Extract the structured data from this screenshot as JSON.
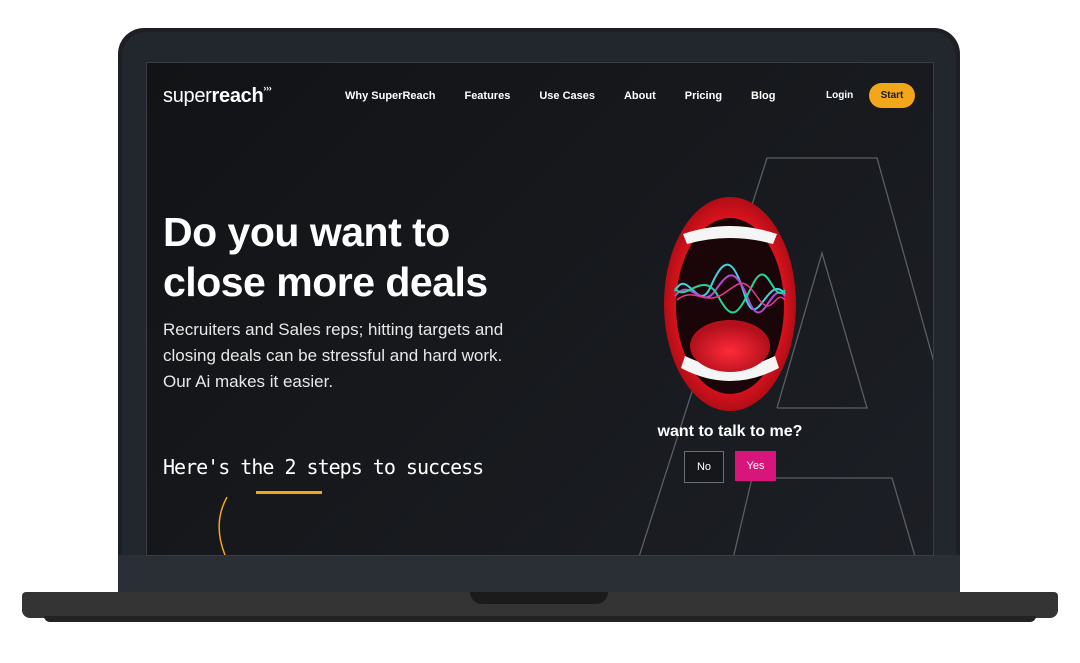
{
  "header": {
    "logo_light": "super",
    "logo_bold": "reach",
    "logo_mark": "›››",
    "nav": [
      "Why SuperReach",
      "Features",
      "Use Cases",
      "About",
      "Pricing",
      "Blog"
    ],
    "login": "Login",
    "start": "Start"
  },
  "hero": {
    "headline_line1": "Do you want to",
    "headline_line2": "close more deals",
    "sub_line1": "Recruiters and Sales reps; hitting targets and",
    "sub_line2": "closing deals can be stressful and hard work.",
    "sub_line3": "Our Ai makes it easier.",
    "steps": "Here's the 2 steps to success"
  },
  "chat": {
    "question": "want to talk to me?",
    "no": "No",
    "yes": "Yes"
  },
  "colors": {
    "accent": "#f2a71b",
    "yes": "#d8157a"
  }
}
